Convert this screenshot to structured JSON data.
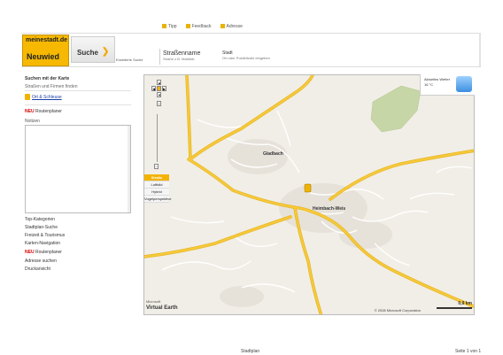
{
  "top_links": [
    {
      "label": "Tipp"
    },
    {
      "label": "Feedback"
    },
    {
      "label": "Adresse"
    }
  ],
  "header": {
    "logo_top": "meinestadt.de",
    "logo_city": "Neuwied",
    "search_tab": "Suche",
    "erweitert": "Erweiterte Suche",
    "street_label": "Straßenname",
    "street_sub": "Straße z.B. Marktstr.",
    "street2_label": "Stadt",
    "street2_sub": "Ort oder Postleitzahl eingeben"
  },
  "left_panel": {
    "search_title": "Suchen mit der Karte",
    "search_sub": "Straßen und Firmen finden",
    "ort_link": "Ort & Schleuse",
    "neu1_badge": "NEU",
    "neu1_text": "Routenplaner",
    "notes_label": "Notizen",
    "links": [
      "Top-Kategorien",
      "Stadtplan-Suche",
      "Freizeit & Tourismus",
      "Karten-Navigation"
    ],
    "neu2_badge": "NEU",
    "neu2_text": "Routenplaner",
    "links2": [
      "Adresse suchen",
      "Druckansicht"
    ]
  },
  "map": {
    "view_buttons": [
      "Straße",
      "Luftbild",
      "Hybrid",
      "Vogelperspektive"
    ],
    "active_view": "Straße",
    "weather_title": "Aktuelles Wetter",
    "weather_sub": "16 °C",
    "place_labels": [
      "Gladbach",
      "Heimbach-Weis"
    ],
    "copyright": "© 2008 Microsoft Corporation",
    "brand": "Virtual Earth",
    "scale": "0,9 km",
    "colors": {
      "road_major": "#f6c93c",
      "road_minor": "#ffffff",
      "forest": "#c6d6a6",
      "land": "#f1eee7",
      "accent": "#f3b300"
    }
  },
  "footer": {
    "center": "Stadtplan",
    "right": "Seite 1 von 1"
  }
}
